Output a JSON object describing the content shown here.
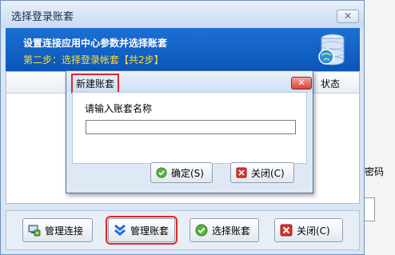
{
  "main_window": {
    "title": "选择登录账套",
    "close_glyph": "✕"
  },
  "header": {
    "line1": "设置连接应用中心参数并选择账套",
    "line2": "第二步：选择登录帐套【共2步】",
    "icon": "database-globe-icon"
  },
  "list": {
    "columns": [
      "状态"
    ]
  },
  "background_window": {
    "visible_fragment": "密码"
  },
  "toolbar": {
    "buttons": [
      {
        "label": "管理连接",
        "icon": "manage-connection-icon"
      },
      {
        "label": "管理账套",
        "icon": "chevron-down-icon"
      },
      {
        "label": "选择账套",
        "icon": "check-icon"
      },
      {
        "label": "关闭(C)",
        "icon": "close-icon"
      }
    ]
  },
  "dialog": {
    "title": "新建账套",
    "close_glyph": "✕",
    "prompt": "请输入账套名称",
    "input_value": "",
    "ok_label": "确定(S)",
    "cancel_label": "关闭(C)"
  },
  "colors": {
    "header_blue": "#0a56b8",
    "header_step_yellow": "#ffdd33",
    "highlight_red": "#e0262c"
  }
}
